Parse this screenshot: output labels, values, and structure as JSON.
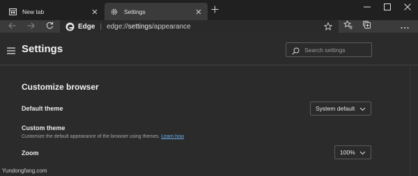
{
  "tabs": [
    {
      "label": "New tab",
      "active": false,
      "icon": "new-tab-page-icon"
    },
    {
      "label": "Settings",
      "active": true,
      "icon": "gear-icon"
    }
  ],
  "toolbar": {
    "omnibox": {
      "brand": "Edge",
      "separator": "|",
      "url_prefix": "edge://",
      "url_host": "settings",
      "url_path": "/appearance"
    }
  },
  "header": {
    "title": "Settings",
    "search_placeholder": "Search settings"
  },
  "section": {
    "title": "Customize browser",
    "default_theme": {
      "label": "Default theme",
      "value": "System default"
    },
    "custom_theme": {
      "label": "Custom theme",
      "description": "Customize the default appearance of the browser using themes.",
      "link": "Learn how"
    },
    "zoom": {
      "label": "Zoom",
      "value": "100%"
    }
  },
  "watermark": "Yundongfang.com",
  "colors": {
    "tab_strip": "#202020",
    "active_tab": "#3b3b3b",
    "page_bg": "#2b2b2b",
    "link": "#6aaef0"
  }
}
